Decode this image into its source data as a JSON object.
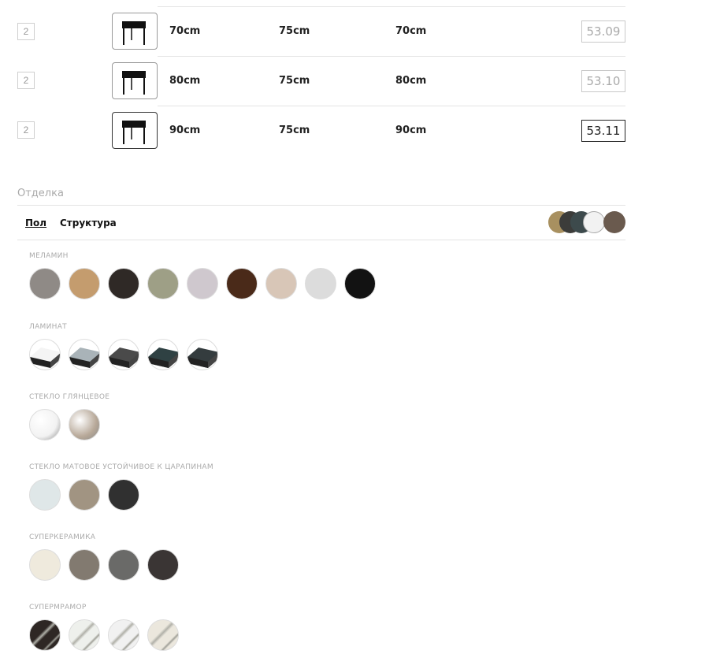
{
  "rows": [
    {
      "qty": "2",
      "w": "70cm",
      "h": "75cm",
      "d": "70cm",
      "code": "53.09",
      "selected": false
    },
    {
      "qty": "2",
      "w": "80cm",
      "h": "75cm",
      "d": "80cm",
      "code": "53.10",
      "selected": false
    },
    {
      "qty": "2",
      "w": "90cm",
      "h": "75cm",
      "d": "90cm",
      "code": "53.11",
      "selected": true
    }
  ],
  "finish": {
    "title": "Отделка",
    "tabs": [
      {
        "label": "Пол",
        "active": true
      },
      {
        "label": "Структура",
        "active": false
      }
    ],
    "preview_colors": [
      "#a89060",
      "#3c3c3a",
      "#3d4a4c",
      "#f2f2f2",
      "#6a5a4e"
    ],
    "groups": [
      {
        "label": "меламин",
        "swatches": [
          {
            "color": "#8f8a86",
            "icon": "melamine-swatch"
          },
          {
            "color": "#c49c6e",
            "icon": "melamine-swatch"
          },
          {
            "color": "#2f2926",
            "icon": "melamine-swatch"
          },
          {
            "color": "#9e9f86",
            "icon": "melamine-swatch"
          },
          {
            "color": "#cfc8ce",
            "icon": "melamine-swatch"
          },
          {
            "color": "#4a2a19",
            "icon": "melamine-swatch"
          },
          {
            "color": "#d8c6b7",
            "icon": "melamine-swatch"
          },
          {
            "color": "#dcdcdc",
            "icon": "melamine-swatch"
          },
          {
            "color": "#121212",
            "icon": "melamine-swatch"
          }
        ]
      },
      {
        "label": "ламинат",
        "swatches": [
          {
            "color": "#f4f4f4",
            "icon": "laminate-swatch"
          },
          {
            "color": "#a9b3b8",
            "icon": "laminate-swatch"
          },
          {
            "color": "#4a4a4a",
            "icon": "laminate-swatch"
          },
          {
            "color": "#2f4143",
            "icon": "laminate-swatch"
          },
          {
            "color": "#343c3e",
            "icon": "laminate-swatch"
          }
        ]
      },
      {
        "label": "стекло глянцевое",
        "swatches": [
          {
            "color": "#f2f2f2",
            "icon": "glass-swatch"
          },
          {
            "color": "#b7a898",
            "icon": "glass-swatch"
          }
        ]
      },
      {
        "label": "стекло матовое устойчивое к царапинам",
        "swatches": [
          {
            "color": "#dfe7e8",
            "icon": "glass-matte-swatch"
          },
          {
            "color": "#a19482",
            "icon": "glass-matte-swatch"
          },
          {
            "color": "#303030",
            "icon": "glass-matte-swatch"
          }
        ]
      },
      {
        "label": "суперкерамика",
        "swatches": [
          {
            "color": "#efeadd",
            "icon": "ceramic-swatch"
          },
          {
            "color": "#827a70",
            "icon": "ceramic-swatch"
          },
          {
            "color": "#6a6a68",
            "icon": "ceramic-swatch"
          },
          {
            "color": "#3a3534",
            "icon": "ceramic-swatch"
          }
        ]
      },
      {
        "label": "супермрамор",
        "swatches": [
          {
            "color": "#2e2724",
            "icon": "marble-swatch"
          },
          {
            "color": "#eef0ec",
            "icon": "marble-swatch"
          },
          {
            "color": "#f1f1f1",
            "icon": "marble-swatch"
          },
          {
            "color": "#ebe7dd",
            "icon": "marble-swatch"
          }
        ]
      }
    ]
  }
}
